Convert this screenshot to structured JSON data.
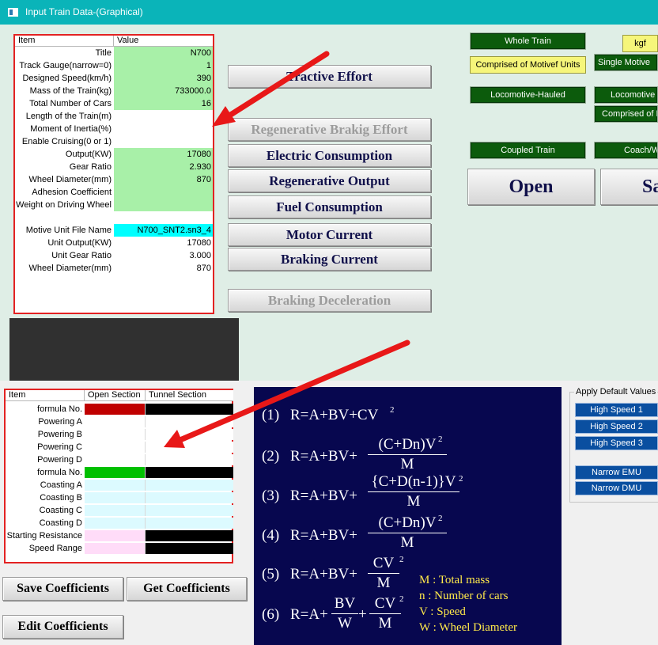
{
  "window": {
    "title": "Input Train Data-(Graphical)"
  },
  "train_grid": {
    "headers": [
      "Item",
      "Value"
    ],
    "rows": [
      {
        "item": "Title",
        "value": "N700"
      },
      {
        "item": "Track Gauge(narrow=0)",
        "value": "1"
      },
      {
        "item": "Designed Speed(km/h)",
        "value": "390"
      },
      {
        "item": "Mass of the Train(kg)",
        "value": "733000.0"
      },
      {
        "item": "Total Number of Cars",
        "value": "16"
      },
      {
        "item": "Length of the Train(m)",
        "value": ""
      },
      {
        "item": "Moment of Inertia(%)",
        "value": ""
      },
      {
        "item": "Enable Cruising(0 or  1)",
        "value": ""
      },
      {
        "item": "Output(KW)",
        "value": "17080"
      },
      {
        "item": "Gear Ratio",
        "value": "2.930"
      },
      {
        "item": "Wheel Diameter(mm)",
        "value": "870"
      },
      {
        "item": "Adhesion Coefficient",
        "value": ""
      },
      {
        "item": "Weight on Driving Wheel",
        "value": ""
      },
      {
        "item": "",
        "value": ""
      },
      {
        "item": "Motive Unit File Name",
        "value": "N700_SNT2.sn3_4"
      },
      {
        "item": "Unit Output(KW)",
        "value": "17080"
      },
      {
        "item": "Unit Gear Ratio",
        "value": "3.000"
      },
      {
        "item": "Wheel Diameter(mm)",
        "value": "870"
      }
    ]
  },
  "effort_buttons": {
    "tractive": "Tractive Effort",
    "regen_braking": "Regenerative Brakig Effort",
    "electric": "Electric Consumption",
    "regen_output": "Regenerative Output",
    "fuel": "Fuel Consumption",
    "motor": "Motor Current",
    "braking_current": "Braking Current",
    "braking_decel": "Braking Deceleration"
  },
  "train_type": {
    "whole_train": "Whole Train",
    "kgf": "kgf",
    "comprised_motive": "Comprised of Motivef Units",
    "single_motive": "Single Motive",
    "loco_hauled": "Locomotive-Hauled",
    "locomotive": "Locomotive",
    "comprised_m": "Comprised of M",
    "coupled": "Coupled Train",
    "coach": "Coach/W"
  },
  "file_buttons": {
    "open": "Open",
    "save": "Save"
  },
  "coef_grid": {
    "headers": [
      "Item",
      "Open Section",
      "Tunnel Section"
    ],
    "rows": [
      {
        "item": "formula No."
      },
      {
        "item": "Powering A"
      },
      {
        "item": "Powering B"
      },
      {
        "item": "Powering C"
      },
      {
        "item": "Powering D"
      },
      {
        "item": "formula No."
      },
      {
        "item": "Coasting A"
      },
      {
        "item": "Coasting B"
      },
      {
        "item": "Coasting C"
      },
      {
        "item": "Coasting D"
      },
      {
        "item": "Starting Resistance"
      },
      {
        "item": "Speed Range"
      }
    ]
  },
  "coef_buttons": {
    "save": "Save Coefficients",
    "get": "Get Coefficients",
    "edit": "Edit Coefficients"
  },
  "defaults": {
    "legend": "Apply Default Values",
    "high1": "High Speed 1",
    "high2": "High Speed 2",
    "high3": "High Speed 3",
    "narrow_emu": "Narrow EMU",
    "narrow_dmu": "Narrow DMU"
  },
  "formulas": {
    "n1": "(1)",
    "n2": "(2)",
    "n3": "(3)",
    "n4": "(4)",
    "n5": "(5)",
    "n6": "(6)",
    "f1": "R=A+BV+CV",
    "base": "R=A+BV+",
    "base6": "R=A+",
    "sq": "2",
    "cdn": "(C+Dn)V",
    "cdn1": "{C+D(n-1)}V",
    "m": "M",
    "cv": "CV",
    "bv": "BV",
    "w": "W",
    "plus": "+",
    "leg_m": "M : Total mass",
    "leg_n": "n  : Number of cars",
    "leg_v": "V : Speed",
    "leg_w": "W : Wheel Diameter"
  },
  "colors": {
    "accent_title": "#0ab4b9",
    "grid_border": "#e32222",
    "green_cell": "#a8f0a8",
    "cyan_cell": "#00ffff"
  }
}
